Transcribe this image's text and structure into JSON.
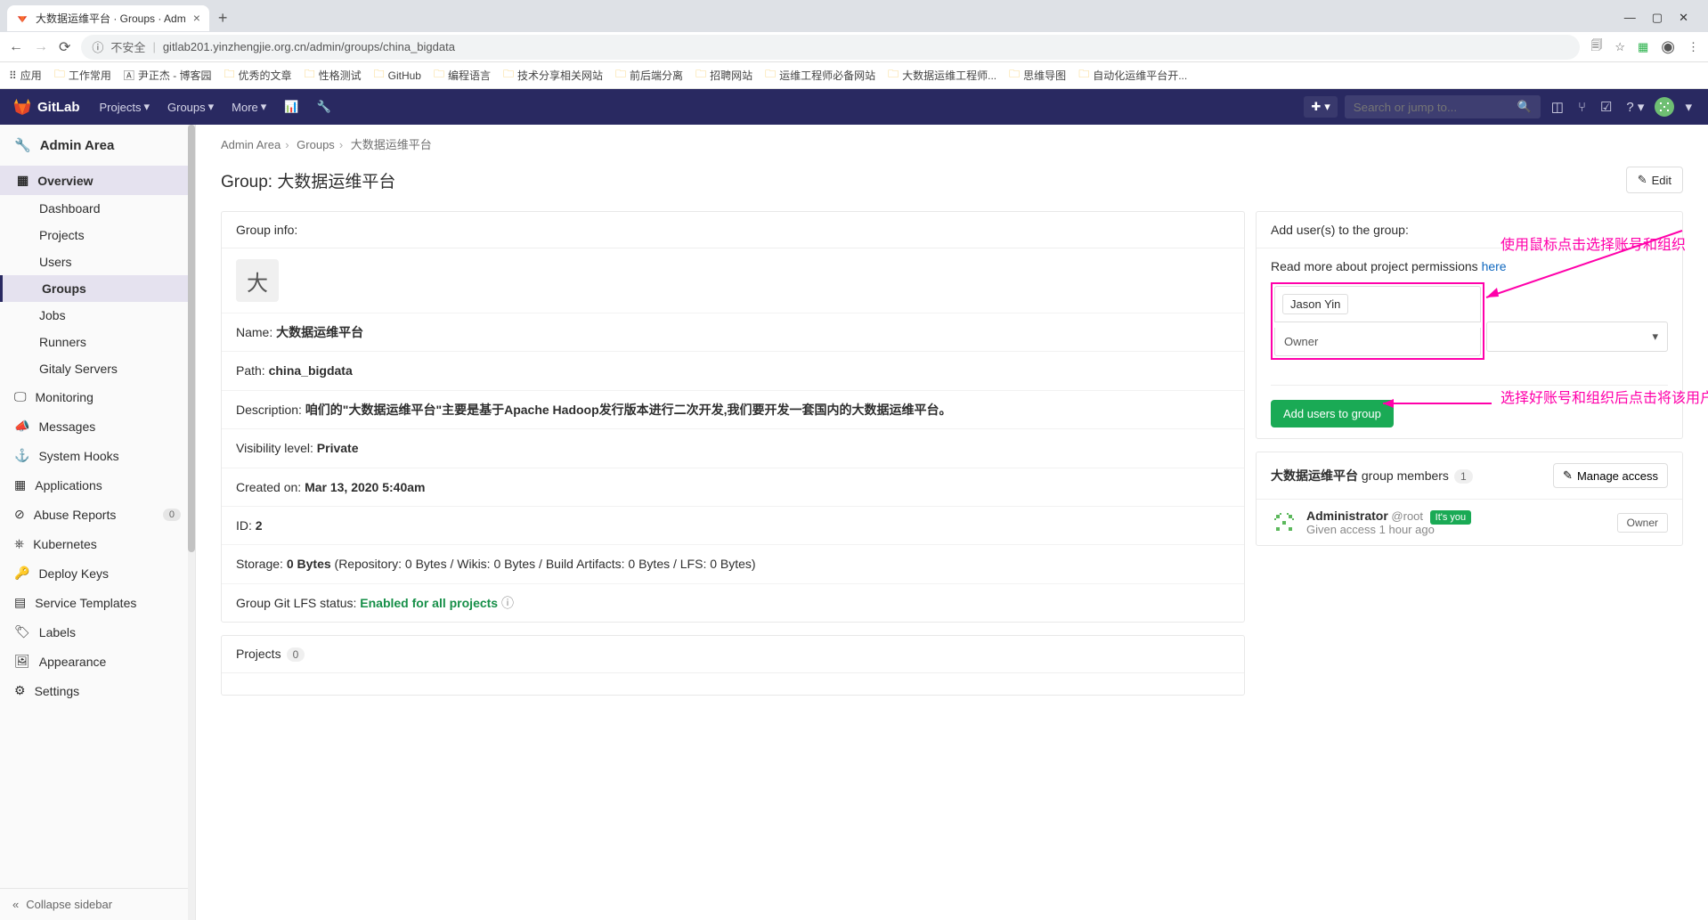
{
  "browser": {
    "tab_title": "大数据运维平台 · Groups · Adm",
    "url_security": "不安全",
    "url": "gitlab201.yinzhengjie.org.cn/admin/groups/china_bigdata",
    "bookmarks": [
      "应用",
      "工作常用",
      "尹正杰 - 博客园",
      "优秀的文章",
      "性格测试",
      "GitHub",
      "编程语言",
      "技术分享相关网站",
      "前后端分离",
      "招聘网站",
      "运维工程师必备网站",
      "大数据运维工程师...",
      "思维导图",
      "自动化运维平台开..."
    ]
  },
  "gitlab_header": {
    "brand": "GitLab",
    "nav": {
      "projects": "Projects",
      "groups": "Groups",
      "more": "More"
    },
    "search_placeholder": "Search or jump to..."
  },
  "sidebar": {
    "title": "Admin Area",
    "overview": "Overview",
    "overview_items": [
      "Dashboard",
      "Projects",
      "Users",
      "Groups",
      "Jobs",
      "Runners",
      "Gitaly Servers"
    ],
    "overview_active": "Groups",
    "items": [
      {
        "label": "Monitoring"
      },
      {
        "label": "Messages"
      },
      {
        "label": "System Hooks"
      },
      {
        "label": "Applications"
      },
      {
        "label": "Abuse Reports",
        "badge": "0"
      },
      {
        "label": "Kubernetes"
      },
      {
        "label": "Deploy Keys"
      },
      {
        "label": "Service Templates"
      },
      {
        "label": "Labels"
      },
      {
        "label": "Appearance"
      },
      {
        "label": "Settings"
      }
    ],
    "collapse": "Collapse sidebar"
  },
  "breadcrumbs": {
    "admin": "Admin Area",
    "groups": "Groups",
    "current": "大数据运维平台"
  },
  "page": {
    "title_prefix": "Group: ",
    "title": "大数据运维平台",
    "edit": "Edit"
  },
  "group_info": {
    "header": "Group info:",
    "avatar_char": "大",
    "name_label": "Name: ",
    "name": "大数据运维平台",
    "path_label": "Path: ",
    "path": "china_bigdata",
    "desc_label": "Description: ",
    "desc": "咱们的\"大数据运维平台\"主要是基于Apache Hadoop发行版本进行二次开发,我们要开发一套国内的大数据运维平台。",
    "vis_label": "Visibility level: ",
    "vis": "Private",
    "created_label": "Created on: ",
    "created": "Mar 13, 2020 5:40am",
    "id_label": "ID: ",
    "id": "2",
    "storage_label": "Storage: ",
    "storage_value": "0 Bytes",
    "storage_detail": " (Repository: 0 Bytes / Wikis: 0 Bytes / Build Artifacts: 0 Bytes / LFS: 0 Bytes)",
    "lfs_label": "Group Git LFS status: ",
    "lfs_value": "Enabled for all projects"
  },
  "projects_panel": {
    "title": "Projects",
    "count": "0"
  },
  "add_users": {
    "header": "Add user(s) to the group:",
    "permissions_text": "Read more about project permissions ",
    "permissions_link": "here",
    "user_token": "Jason Yin",
    "role": "Owner",
    "button": "Add users to group"
  },
  "annotations": {
    "top": "使用鼠标点击选择账号和组织",
    "bottom": "选择好账号和组织后点击将该用户加入到项目组"
  },
  "members": {
    "group_name": "大数据运维平台",
    "label_suffix": " group members",
    "count": "1",
    "manage": "Manage access",
    "member": {
      "name": "Administrator",
      "username": "@root",
      "its_you": "It's you",
      "access_time": "Given access 1 hour ago",
      "role": "Owner"
    }
  }
}
